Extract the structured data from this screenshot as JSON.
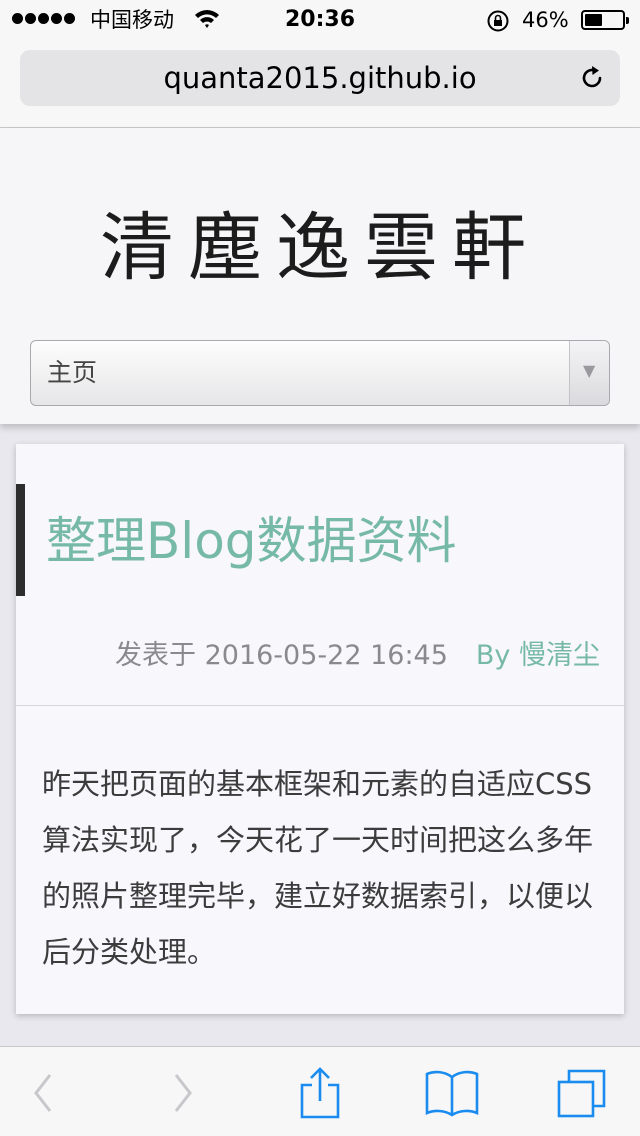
{
  "status_bar": {
    "carrier": "中国移动",
    "time": "20:36",
    "battery_percent": "46%",
    "battery_level": 0.46
  },
  "browser": {
    "url": "quanta2015.github.io"
  },
  "site": {
    "title": "清塵逸雲軒",
    "nav_selected": "主页"
  },
  "post": {
    "title": "整理Blog数据资料",
    "date": "发表于 2016-05-22 16:45",
    "author": "By 慢清尘",
    "body": "昨天把页面的基本框架和元素的自适应CSS算法实现了，今天花了一天时间把这么多年的照片整理完毕，建立好数据索引，以便以后分类处理。"
  },
  "colors": {
    "accent": "#76b9a6",
    "ios_blue": "#1a8cf0"
  }
}
